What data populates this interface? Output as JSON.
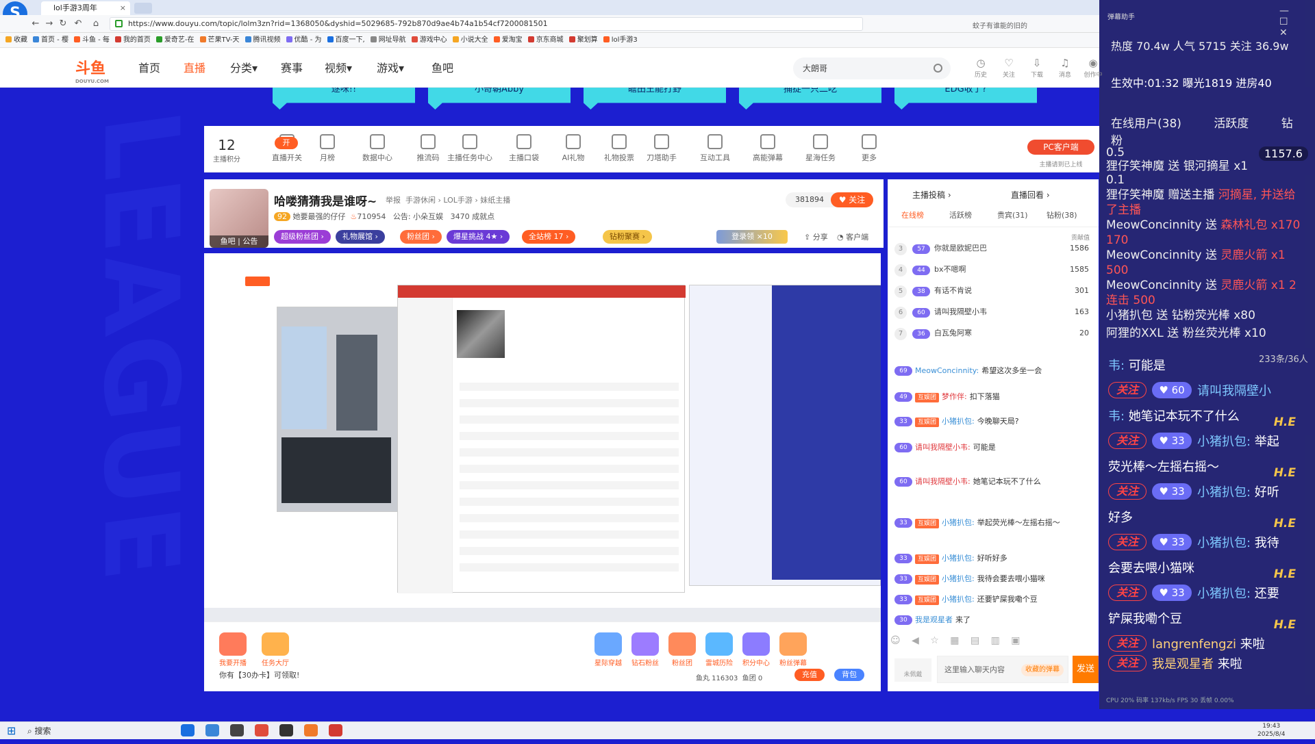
{
  "browser": {
    "tab_title": "lol手游3周年",
    "url": "https://www.douyu.com/topic/lolm3zn?rid=1368050&dyshid=5029685-792b870d9ae4b74a1b54cf7200081501",
    "addr_right": "蚊子有谁能的旧的",
    "bookmarks": [
      "收藏",
      "首页 - 樱",
      "斗鱼 - 每",
      "我的首页",
      "爱奇艺-在",
      "芒果TV-天",
      "腾讯视频",
      "优酷 - 为",
      "百度一下,",
      "网址导航",
      "游戏中心",
      "小说大全",
      "爱淘宝",
      "京东商城",
      "聚划算",
      "lol手游3"
    ]
  },
  "header": {
    "logo": "斗鱼",
    "logo_sub": "DOUYU.COM",
    "nav": [
      "首页",
      "直播",
      "分类▾",
      "赛事",
      "视频▾",
      "游戏▾",
      "鱼吧"
    ],
    "search_value": "大朗哥",
    "icons": [
      {
        "name": "history",
        "label": "历史",
        "glyph": "◷"
      },
      {
        "name": "follow",
        "label": "关注",
        "glyph": "♡"
      },
      {
        "name": "download",
        "label": "下载",
        "glyph": "⇩"
      },
      {
        "name": "message",
        "label": "消息",
        "glyph": "♫"
      },
      {
        "name": "create",
        "label": "创作中",
        "glyph": "◉"
      }
    ]
  },
  "banner_tabs": [
    "逐咪!!",
    "小奇朝Abby",
    "瞻田王能打野",
    "捕捉一只二吃",
    "EDG收了?"
  ],
  "studio_tools": {
    "score_value": "12",
    "score_label": "主播积分",
    "items": [
      "直播开关",
      "月榜",
      "数据中心",
      "推流码",
      "主播任务中心",
      "主播口袋",
      "AI礼物",
      "礼物投票",
      "刀塔助手",
      "互动工具",
      "高能弹幕",
      "星海任务",
      "更多"
    ],
    "open_badge": "开",
    "pc_client": "PC客户端",
    "pc_sub": "主播请到已上线"
  },
  "room": {
    "avatar_caption": "鱼吧 | 公告",
    "title": "哈喽猜猜我是谁呀~",
    "report": "举报",
    "category": "手游休闲 › LOL手游 › 妹纸主播",
    "level": "92",
    "subtitle": "她要最强的仔仔",
    "hot": "710954",
    "notice": "公告: 小朵互娱",
    "fans_gift": "3470 成就点",
    "follow_count": "381894",
    "follow_label": "关注",
    "pills": [
      "超级粉丝团 ›",
      "礼物展馆 ›",
      "粉丝团 ›",
      "爆星挑战 4★ ›",
      "全站榜 17 ›",
      "钻粉聚赛 ›"
    ],
    "login_btn": "登录领 ×10",
    "share": "分享",
    "service": "客户端"
  },
  "bottom": {
    "buttons": [
      "我要开播",
      "任务大厅"
    ],
    "coupon": "你有【30办卡】可领取!",
    "gift_buttons": [
      "星际穿越",
      "钻石粉丝",
      "粉丝团",
      "雷城历险",
      "积分中心",
      "粉丝弹幕"
    ],
    "fishball": "鱼丸 116303",
    "fishteam": "鱼团 0",
    "recharge": "充值",
    "backpack": "背包"
  },
  "right_panel": {
    "top_tabs": [
      "主播投稿 ›",
      "直播回看 ›"
    ],
    "tabs": [
      "在线榜",
      "活跃榜",
      "贵宾(31)",
      "钻粉(38)"
    ],
    "contrib_label": "贡献值",
    "ranks": [
      {
        "no": "3",
        "lv": "57",
        "name": "你就是欧妮巴巴",
        "value": "1586"
      },
      {
        "no": "4",
        "lv": "44",
        "name": "bx不嗯啊",
        "value": "1585"
      },
      {
        "no": "5",
        "lv": "38",
        "name": "有话不肯说",
        "value": "301"
      },
      {
        "no": "6",
        "lv": "60",
        "name": "请叫我隔壁小韦",
        "value": "163"
      },
      {
        "no": "7",
        "lv": "36",
        "name": "白瓦兔阿寒",
        "value": "20"
      }
    ],
    "chats": [
      {
        "lv": "69",
        "fan": "",
        "name": "MeowConcinnity:",
        "text": "希望这次多坐一会",
        "red": false
      },
      {
        "lv": "49",
        "fan": "互娱团",
        "name": "梦作伴:",
        "text": "扣下落猫",
        "red": true
      },
      {
        "lv": "33",
        "fan": "互娱团",
        "name": "小猪扒包:",
        "text": "今晚聊天局?",
        "red": false
      },
      {
        "lv": "60",
        "fan": "",
        "name": "请叫我隔壁小韦:",
        "text": "可能是",
        "red": true
      },
      {
        "lv": "60",
        "fan": "",
        "name": "请叫我隔壁小韦:",
        "text": "她笔记本玩不了什么",
        "red": true
      },
      {
        "lv": "33",
        "fan": "互娱团",
        "name": "小猪扒包:",
        "text": "举起荧光棒～左摇右摇～",
        "red": false
      },
      {
        "lv": "33",
        "fan": "互娱团",
        "name": "小猪扒包:",
        "text": "好听好多",
        "red": false
      },
      {
        "lv": "33",
        "fan": "互娱团",
        "name": "小猪扒包:",
        "text": "我待会要去喂小猫咪",
        "red": false
      },
      {
        "lv": "33",
        "fan": "互娱团",
        "name": "小猪扒包:",
        "text": "还要铲屎我嘞个豆",
        "red": false
      },
      {
        "lv": "30",
        "fan": "",
        "name": "我是观星者",
        "text": "来了",
        "red": false
      }
    ],
    "no_medal": "未佩戴",
    "input_placeholder": "这里输入聊天内容",
    "collect_danmu": "收藏的弹幕",
    "send": "发送"
  },
  "overlay": {
    "title": "弹幕助手",
    "stats": "热度 70.4w  人气 5715  关注 36.9w",
    "live": "生效中:01:32  曝光1819  进房40",
    "tabs": [
      "在线用户(38)",
      "活跃度",
      "钻粉"
    ],
    "revenue": "1157.6",
    "gifts": [
      {
        "a": "0.5",
        "b": ""
      },
      {
        "a": "狸仔笑神魔 送 银河摘星 x1",
        "b": ""
      },
      {
        "a": "0.1",
        "b": ""
      },
      {
        "a": "狸仔笑神魔 赠送主播 ",
        "b": "河摘星, 并送给了主播"
      },
      {
        "a": "MeowConcinnity 送 ",
        "b": "森林礼包 x170  170"
      },
      {
        "a": "MeowConcinnity 送 ",
        "b": "灵鹿火箭 x1  500"
      },
      {
        "a": "MeowConcinnity 送 ",
        "b": "灵鹿火箭 x1 2连击  500"
      },
      {
        "a": "小猪扒包 送 钻粉荧光棒 x80",
        "b": ""
      },
      {
        "a": "阿狸的XXL 送 粉丝荧光棒 x10",
        "b": ""
      }
    ],
    "count": "233条/36人",
    "chats": [
      {
        "prefix": "韦:",
        "text": " 可能是",
        "fb": "",
        "lv": "",
        "name": ""
      },
      {
        "prefix": "",
        "text": "",
        "fb": "关注",
        "lv": "60",
        "name": "请叫我隔壁小"
      },
      {
        "prefix": "韦:",
        "text": " 她笔记本玩不了什么",
        "fb": "",
        "lv": "",
        "name": ""
      },
      {
        "prefix": "",
        "text": " 举起",
        "fb": "关注",
        "lv": "33",
        "name": "小猪扒包:"
      },
      {
        "prefix": "",
        "text": "荧光棒～左摇右摇～",
        "fb": "",
        "lv": "",
        "name": ""
      },
      {
        "prefix": "",
        "text": " 好听",
        "fb": "关注",
        "lv": "33",
        "name": "小猪扒包:"
      },
      {
        "prefix": "",
        "text": "好多",
        "fb": "",
        "lv": "",
        "name": ""
      },
      {
        "prefix": "",
        "text": " 我待",
        "fb": "关注",
        "lv": "33",
        "name": "小猪扒包:"
      },
      {
        "prefix": "",
        "text": "会要去喂小猫咪",
        "fb": "",
        "lv": "",
        "name": ""
      },
      {
        "prefix": "",
        "text": " 还要",
        "fb": "关注",
        "lv": "33",
        "name": "小猪扒包:"
      },
      {
        "prefix": "",
        "text": "铲屎我嘞个豆",
        "fb": "",
        "lv": "",
        "name": ""
      },
      {
        "prefix": "",
        "text": " 来啦",
        "fb": "关注",
        "lv": "",
        "name": "langrenfengzi"
      },
      {
        "prefix": "",
        "text": " 来啦",
        "fb": "关注",
        "lv": "",
        "name": "我是观星者"
      }
    ],
    "he_mark": "H.E",
    "foot": "CPU 20%      码率 137kb/s      FPS 30      丢帧 0.00%"
  },
  "taskbar": {
    "start": "⊞",
    "search": "搜索",
    "time": "19:43",
    "date": "2025/8/4"
  },
  "colors": {
    "brand": "#ff5d23",
    "bg_blue": "#1c1fd0",
    "accent_cyan": "#41d9e7"
  }
}
